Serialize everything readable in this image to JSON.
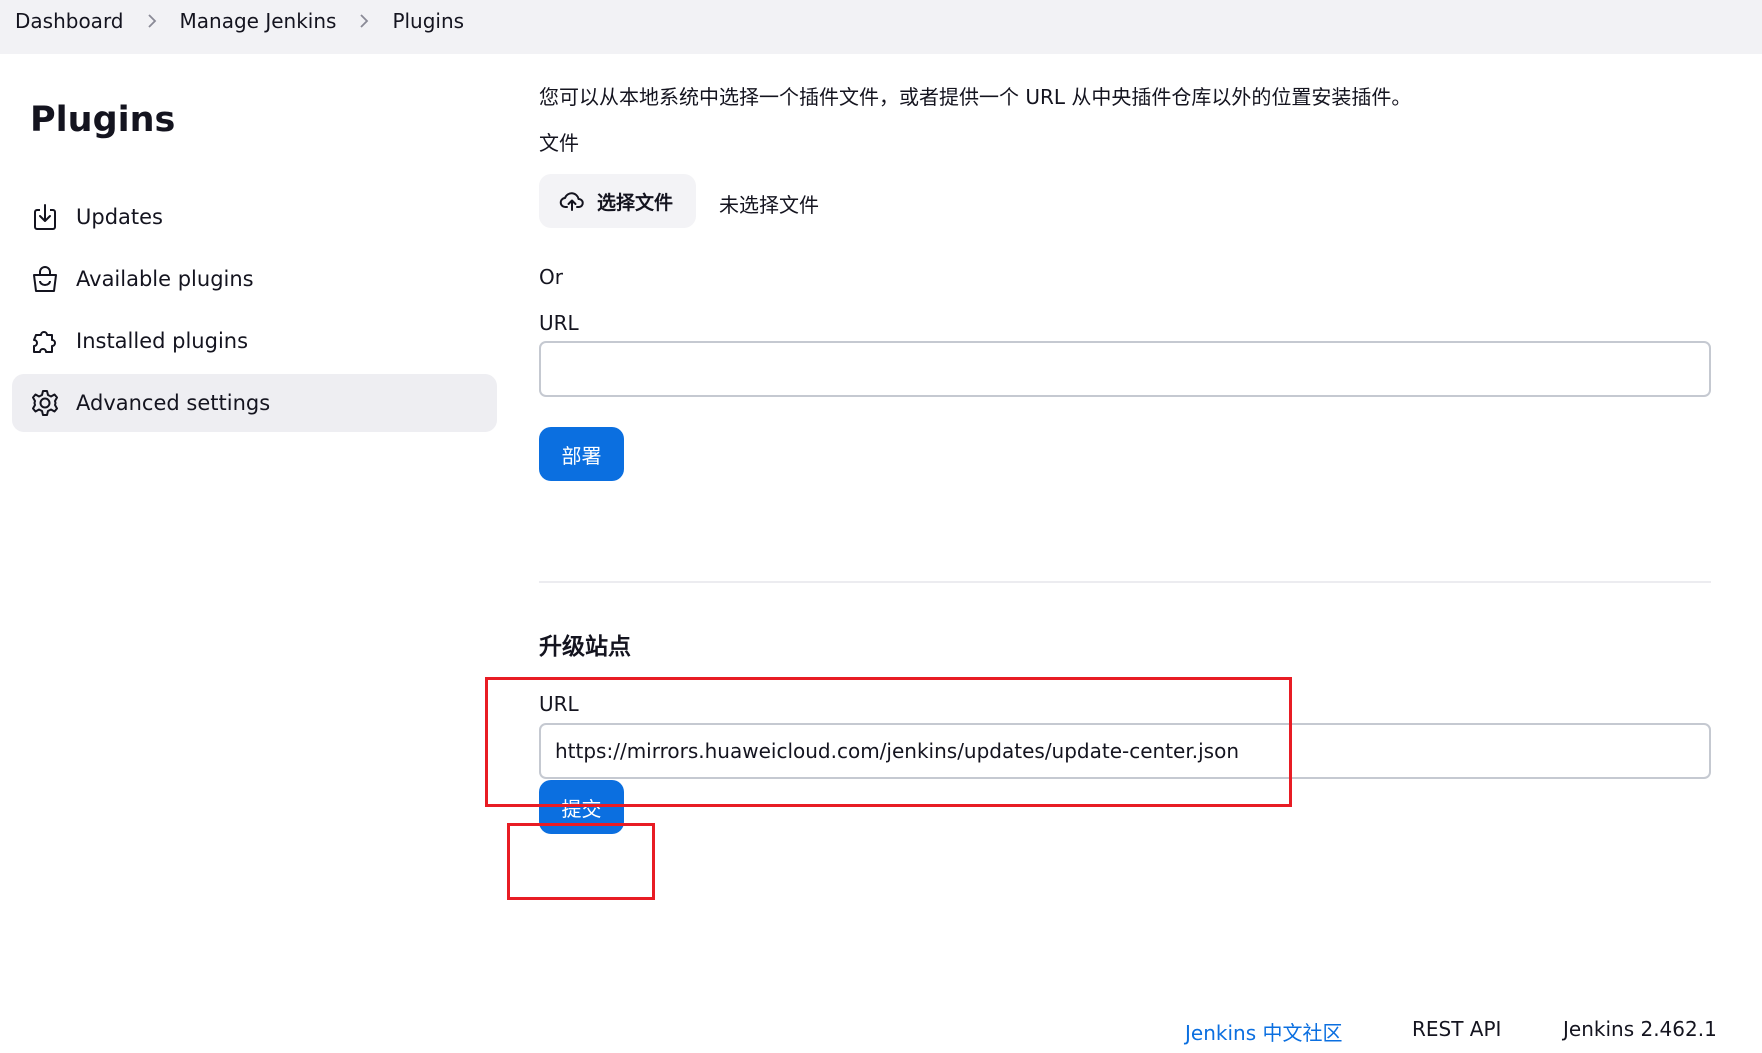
{
  "breadcrumb": {
    "items": [
      "Dashboard",
      "Manage Jenkins",
      "Plugins"
    ]
  },
  "sidebar": {
    "title": "Plugins",
    "items": [
      {
        "label": "Updates",
        "icon": "download-icon"
      },
      {
        "label": "Available plugins",
        "icon": "shopping-bag-icon"
      },
      {
        "label": "Installed plugins",
        "icon": "puzzle-piece-icon"
      },
      {
        "label": "Advanced settings",
        "icon": "gear-icon",
        "active": true
      }
    ]
  },
  "deploy": {
    "intro": "您可以从本地系统中选择一个插件文件，或者提供一个 URL 从中央插件仓库以外的位置安装插件。",
    "file_label": "文件",
    "choose_file_label": "选择文件",
    "no_file_text": "未选择文件",
    "or_text": "Or",
    "url_label": "URL",
    "url_value": "",
    "deploy_button": "部署"
  },
  "update_site": {
    "title": "升级站点",
    "url_label": "URL",
    "url_value": "https://mirrors.huaweicloud.com/jenkins/updates/update-center.json",
    "submit_button": "提交"
  },
  "footer": {
    "community_link": "Jenkins 中文社区",
    "rest_api": "REST API",
    "version": "Jenkins 2.462.1"
  },
  "colors": {
    "primary": "#0b6fe0",
    "highlight": "#e81c24",
    "active_nav_bg": "#eeeef2"
  }
}
